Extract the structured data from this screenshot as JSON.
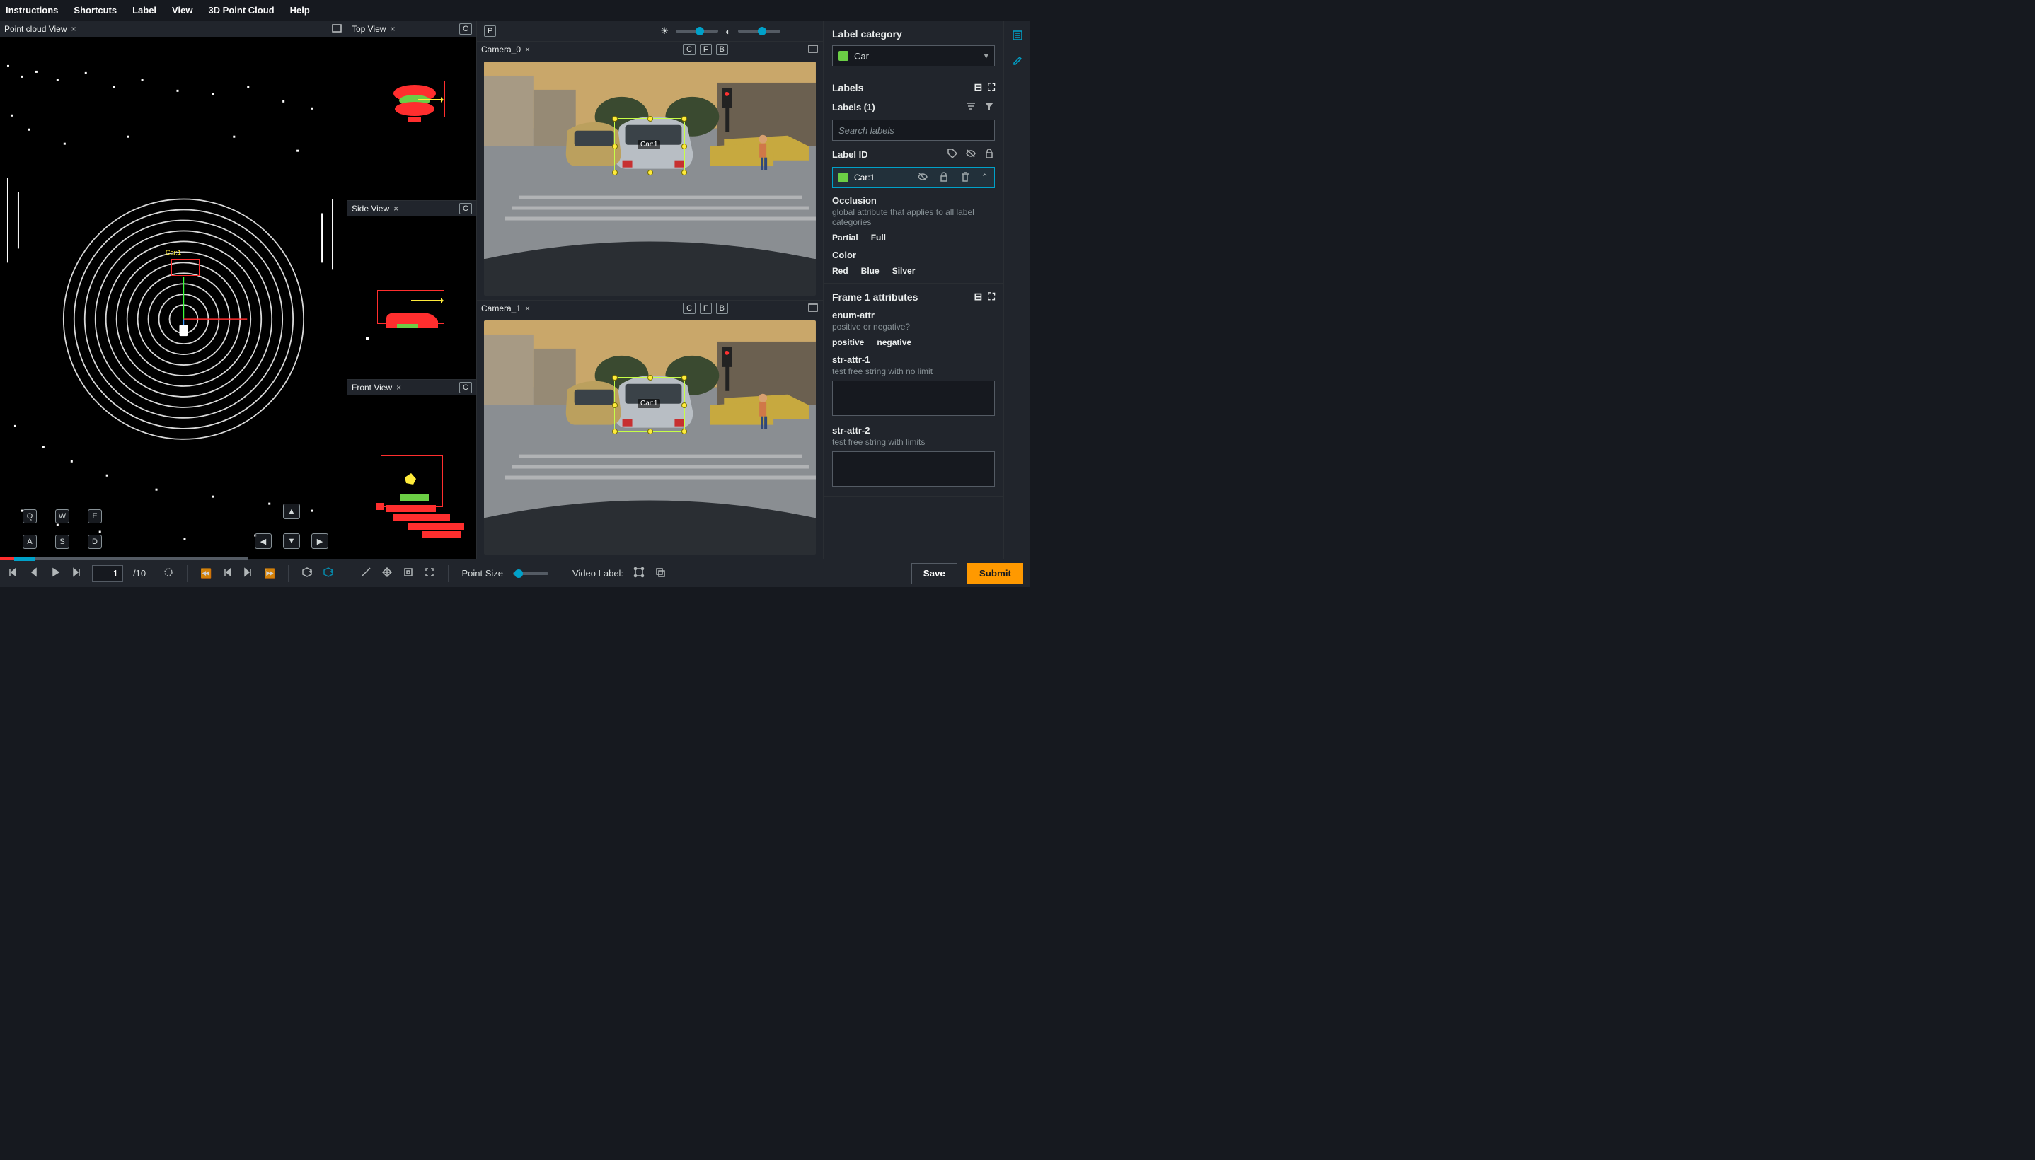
{
  "menu": {
    "instructions": "Instructions",
    "shortcuts": "Shortcuts",
    "label": "Label",
    "view": "View",
    "pc3d": "3D Point Cloud",
    "help": "Help"
  },
  "panels": {
    "pcv": {
      "title": "Point cloud View"
    },
    "top": {
      "title": "Top View",
      "key": "C"
    },
    "side": {
      "title": "Side View",
      "key": "C"
    },
    "front": {
      "title": "Front View",
      "key": "C"
    },
    "cam0": {
      "title": "Camera_0",
      "keyC": "C",
      "keyF": "F",
      "keyB": "B",
      "tag": "Car:1"
    },
    "cam1": {
      "title": "Camera_1",
      "keyC": "C",
      "keyF": "F",
      "keyB": "B",
      "tag": "Car:1"
    },
    "camP": "P"
  },
  "keys": {
    "q": "Q",
    "w": "W",
    "e": "E",
    "a": "A",
    "s": "S",
    "d": "D"
  },
  "pcv_label": "Car:1",
  "sidebar": {
    "labelCategory": "Label category",
    "categoryValue": "Car",
    "labels": "Labels",
    "labelsCount": "Labels (1)",
    "searchPlaceholder": "Search labels",
    "labelId": "Label ID",
    "labelItem": "Car:1",
    "occlusion": {
      "name": "Occlusion",
      "desc": "global attribute that applies to all label categories",
      "opts": [
        "Partial",
        "Full"
      ]
    },
    "color": {
      "name": "Color",
      "opts": [
        "Red",
        "Blue",
        "Silver"
      ]
    },
    "frameAttrs": "Frame 1 attributes",
    "enumAttr": {
      "name": "enum-attr",
      "desc": "positive or negative?",
      "opts": [
        "positive",
        "negative"
      ]
    },
    "strAttr1": {
      "name": "str-attr-1",
      "desc": "test free string with no limit"
    },
    "strAttr2": {
      "name": "str-attr-2",
      "desc": "test free string with limits"
    }
  },
  "bottom": {
    "frame": "1",
    "total": "/10",
    "pointSize": "Point Size",
    "videoLabel": "Video Label:",
    "save": "Save",
    "submit": "Submit"
  }
}
